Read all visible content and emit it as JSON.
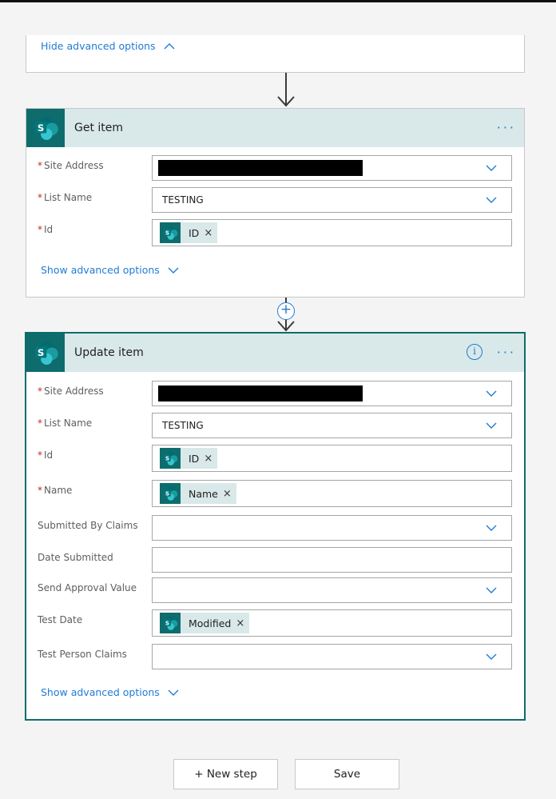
{
  "top_card": {
    "hide_advanced_label": "Hide advanced options"
  },
  "get_item": {
    "title": "Get item",
    "more_label": "···",
    "fields": {
      "site_address": {
        "label": "Site Address",
        "required": "*"
      },
      "list_name": {
        "label": "List Name",
        "required": "*",
        "value": "TESTING"
      },
      "id": {
        "label": "Id",
        "required": "*",
        "token": "ID"
      }
    },
    "show_advanced_label": "Show advanced options"
  },
  "add_step": {
    "plus_label": "+"
  },
  "update_item": {
    "title": "Update item",
    "info_label": "i",
    "more_label": "···",
    "fields": {
      "site_address": {
        "label": "Site Address",
        "required": "*"
      },
      "list_name": {
        "label": "List Name",
        "required": "*",
        "value": "TESTING"
      },
      "id": {
        "label": "Id",
        "required": "*",
        "token": "ID"
      },
      "name": {
        "label": "Name",
        "required": "*",
        "token": "Name"
      },
      "submitted_by_claims": {
        "label": "Submitted By Claims"
      },
      "date_submitted": {
        "label": "Date Submitted"
      },
      "send_approval_value": {
        "label": "Send Approval Value"
      },
      "test_date": {
        "label": "Test Date",
        "token": "Modified"
      },
      "test_person_claims": {
        "label": "Test Person Claims"
      }
    },
    "show_advanced_label": "Show advanced options"
  },
  "token_remove": "×",
  "footer": {
    "new_step_label": "+ New step",
    "save_label": "Save"
  },
  "colors": {
    "accent": "#1f7bd6",
    "sharepoint_teal": "#0e6c6d",
    "header_bg": "#d9e8e9",
    "required": "#c4262e"
  }
}
